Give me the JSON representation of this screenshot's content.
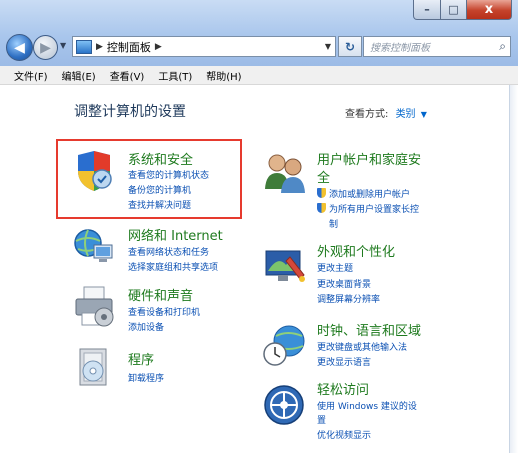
{
  "window": {
    "caption_buttons": {
      "minimize": "–",
      "maximize": "□",
      "close": "x"
    }
  },
  "nav": {
    "back": "◀",
    "forward": "▶",
    "recent": "▼",
    "address": {
      "items": [
        "控制面板"
      ],
      "separator": "▶"
    },
    "refresh": "↻",
    "search_placeholder": "搜索控制面板"
  },
  "menubar": {
    "items": [
      "文件(F)",
      "编辑(E)",
      "查看(V)",
      "工具(T)",
      "帮助(H)"
    ]
  },
  "main": {
    "heading": "调整计算机的设置",
    "view_by": {
      "label": "查看方式:",
      "value": "类别",
      "arrow": "▼"
    }
  },
  "categories": [
    {
      "title": "系统和安全",
      "icon": "shield-check-icon",
      "links": [
        "查看您的计算机状态",
        "备份您的计算机",
        "查找并解决问题"
      ]
    },
    {
      "title": "网络和 Internet",
      "icon": "network-icon",
      "links": [
        "查看网络状态和任务",
        "选择家庭组和共享选项"
      ]
    },
    {
      "title": "硬件和声音",
      "icon": "printer-icon",
      "links": [
        "查看设备和打印机",
        "添加设备"
      ]
    },
    {
      "title": "程序",
      "icon": "programs-icon",
      "links": [
        "卸载程序"
      ]
    },
    {
      "title": "用户帐户和家庭安全",
      "title_line1": "用户帐户和家庭安",
      "title_line2": "全",
      "icon": "users-icon",
      "links": [
        "添加或删除用户帐户",
        "为所有用户设置家长控",
        "制"
      ]
    },
    {
      "title": "外观和个性化",
      "icon": "appearance-icon",
      "links": [
        "更改主题",
        "更改桌面背景",
        "调整屏幕分辨率"
      ]
    },
    {
      "title": "时钟、语言和区域",
      "icon": "clock-globe-icon",
      "links": [
        "更改键盘或其他输入法",
        "更改显示语言"
      ]
    },
    {
      "title": "轻松访问",
      "icon": "ease-of-access-icon",
      "links": [
        "使用 Windows 建议的设",
        "置",
        "优化视频显示"
      ]
    }
  ],
  "colors": {
    "category_title": "#1e7a1e",
    "link": "#0b50b3",
    "heading": "#1e395b",
    "highlight": "#e63a2e"
  }
}
